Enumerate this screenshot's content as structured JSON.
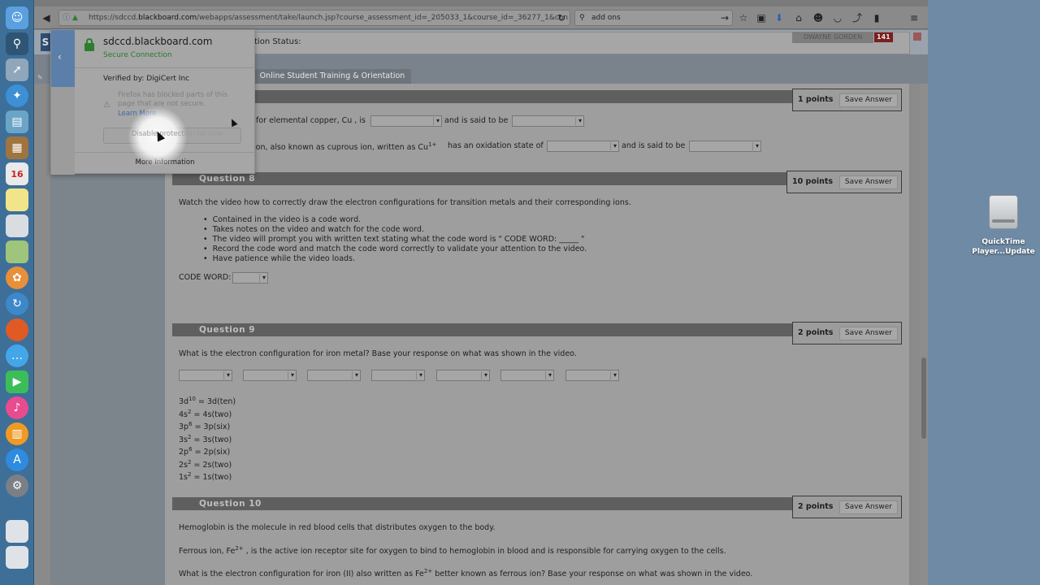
{
  "browser": {
    "url_prefix": "https://sdccd.",
    "url_domain": "blackboard.com",
    "url_path": "/webapps/assessment/take/launch.jsp?course_assessment_id=_205033_1&course_id=_36277_1&con",
    "search_value": "add ons"
  },
  "popup": {
    "domain": "sdccd.blackboard.com",
    "secure": "Secure Connection",
    "verified": "Verified by: DigiCert Inc",
    "warning": "Firefox has blocked parts of this page that are not secure.",
    "learn_more": "Learn More",
    "disable_button": "Disable protection for now",
    "more_info": "More Information"
  },
  "header": {
    "status_label": "tion Status:",
    "user_name": "DWAYNE GORDEN",
    "badge_count": "141",
    "nav_tab": "Online Student Training & Orientation"
  },
  "q7": {
    "points": "1 points",
    "save": "Save Answer",
    "line1_a": "for elemental copper, Cu , is",
    "line1_b": "and is said to be",
    "line2_a": "ion, also known as cuprous ion, written as Cu",
    "line2_sup": "1+",
    "line2_b": "has an oxidation state of",
    "line2_c": "and is said to be"
  },
  "q8": {
    "title": "Question 8",
    "points": "10 points",
    "save": "Save Answer",
    "intro": "Watch the video how to correctly draw the electron configurations for transition metals and their corresponding ions.",
    "bullets": [
      "Contained in the video is a code word.",
      "Takes notes on the video and watch for the code word.",
      "The video will prompt you with written text stating what the code word is \" CODE WORD: _____ \"",
      "Record the code word and match the code word correctly to validate your attention to the video.",
      "Have patience while the video loads."
    ],
    "code_label": "CODE WORD:"
  },
  "q9": {
    "title": "Question 9",
    "points": "2 points",
    "save": "Save Answer",
    "prompt": "What is the electron configuration for iron metal?  Base your response on what was shown in the video.",
    "configs": [
      {
        "base": "3d",
        "sup": "10",
        "rest": " = 3d(ten)"
      },
      {
        "base": "4s",
        "sup": "2",
        "rest": " = 4s(two)"
      },
      {
        "base": "3p",
        "sup": "6",
        "rest": " = 3p(six)"
      },
      {
        "base": "3s",
        "sup": "2",
        "rest": " = 3s(two)"
      },
      {
        "base": "2p",
        "sup": "6",
        "rest": " = 2p(six)"
      },
      {
        "base": "2s",
        "sup": "2",
        "rest": " = 2s(two)"
      },
      {
        "base": "1s",
        "sup": "2",
        "rest": " = 1s(two)"
      }
    ]
  },
  "q10": {
    "title": "Question 10",
    "points": "2 points",
    "save": "Save Answer",
    "line1": "Hemoglobin is the molecule in red blood cells that distributes oxygen to the body.",
    "line2_a": "Ferrous ion, Fe",
    "line2_sup": "2+",
    "line2_b": " , is the active ion receptor site for oxygen to bind to hemoglobin in blood and is responsible for carrying oxygen to the cells.",
    "line3_a": "What is the electron configuration for iron (II) also written as Fe",
    "line3_sup": "2+",
    "line3_b": "  better known as ferrous ion?  Base your response on what was shown in the video."
  },
  "desktop": {
    "drive_label": "QuickTime Player...Update"
  },
  "dock": {
    "calendar_day": "16"
  }
}
